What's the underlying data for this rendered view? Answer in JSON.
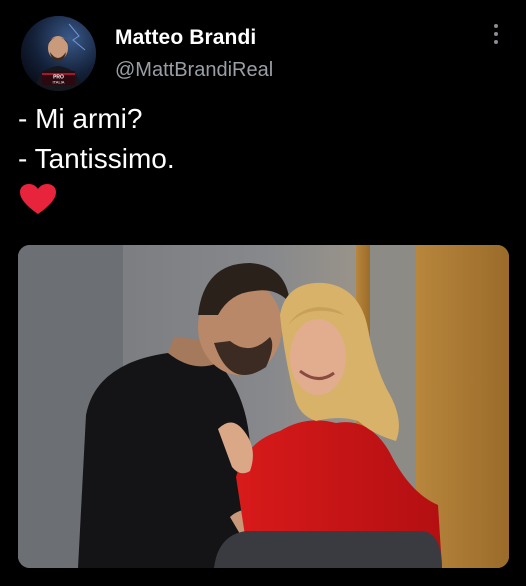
{
  "tweet": {
    "author": {
      "name": "Matteo Brandi",
      "handle": "@MattBrandiReal",
      "avatar_badge": "PRO ITALIA"
    },
    "lines": [
      "- Mi armi?",
      "- Tantissimo."
    ],
    "reaction_icon": "red-heart-icon",
    "more_icon": "vertical-ellipsis-icon"
  },
  "colors": {
    "background": "#000000",
    "name": "#ffffff",
    "handle": "#9a9fa5",
    "heart": "#e8243c"
  }
}
